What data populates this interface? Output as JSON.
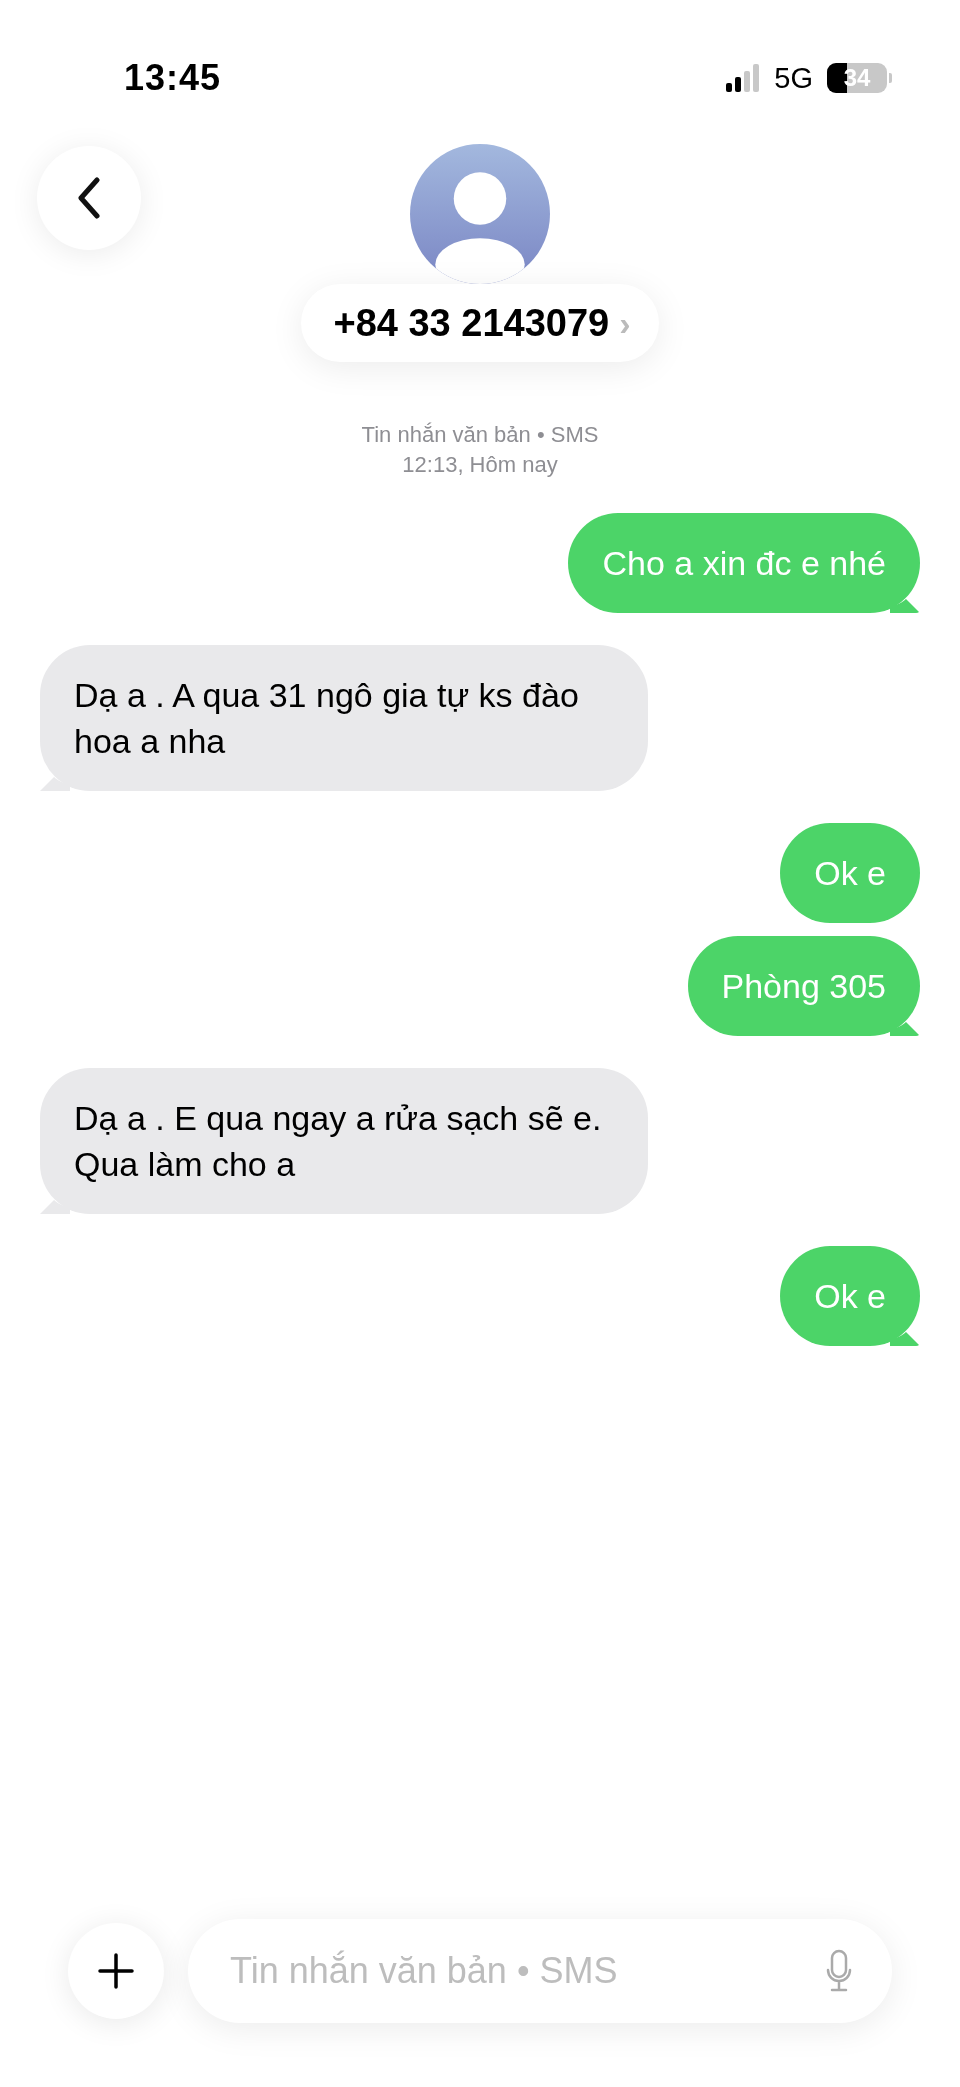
{
  "status_bar": {
    "time": "13:45",
    "network": "5G",
    "battery": "34"
  },
  "contact": {
    "number": "+84 33 2143079",
    "chevron": "›"
  },
  "thread_info": {
    "service": "Tin nhắn văn bản • SMS",
    "timestamp": "12:13, Hôm nay"
  },
  "messages": [
    {
      "kind": "sent",
      "text": "Cho a xin đc e nhé",
      "tail": true
    },
    {
      "kind": "received",
      "text": "Dạ a . A qua 31 ngô gia tự ks đào hoa a nha",
      "tail": true
    },
    {
      "kind": "sent",
      "text": "Ok e",
      "tail": false
    },
    {
      "kind": "sent",
      "text": "Phòng 305",
      "tail": true
    },
    {
      "kind": "received",
      "text": "Dạ a . E qua ngay a rửa sạch sẽ e. Qua làm cho a",
      "tail": true
    },
    {
      "kind": "sent",
      "text": "Ok e",
      "tail": true
    }
  ],
  "composer": {
    "placeholder": "Tin nhắn văn bản • SMS"
  }
}
